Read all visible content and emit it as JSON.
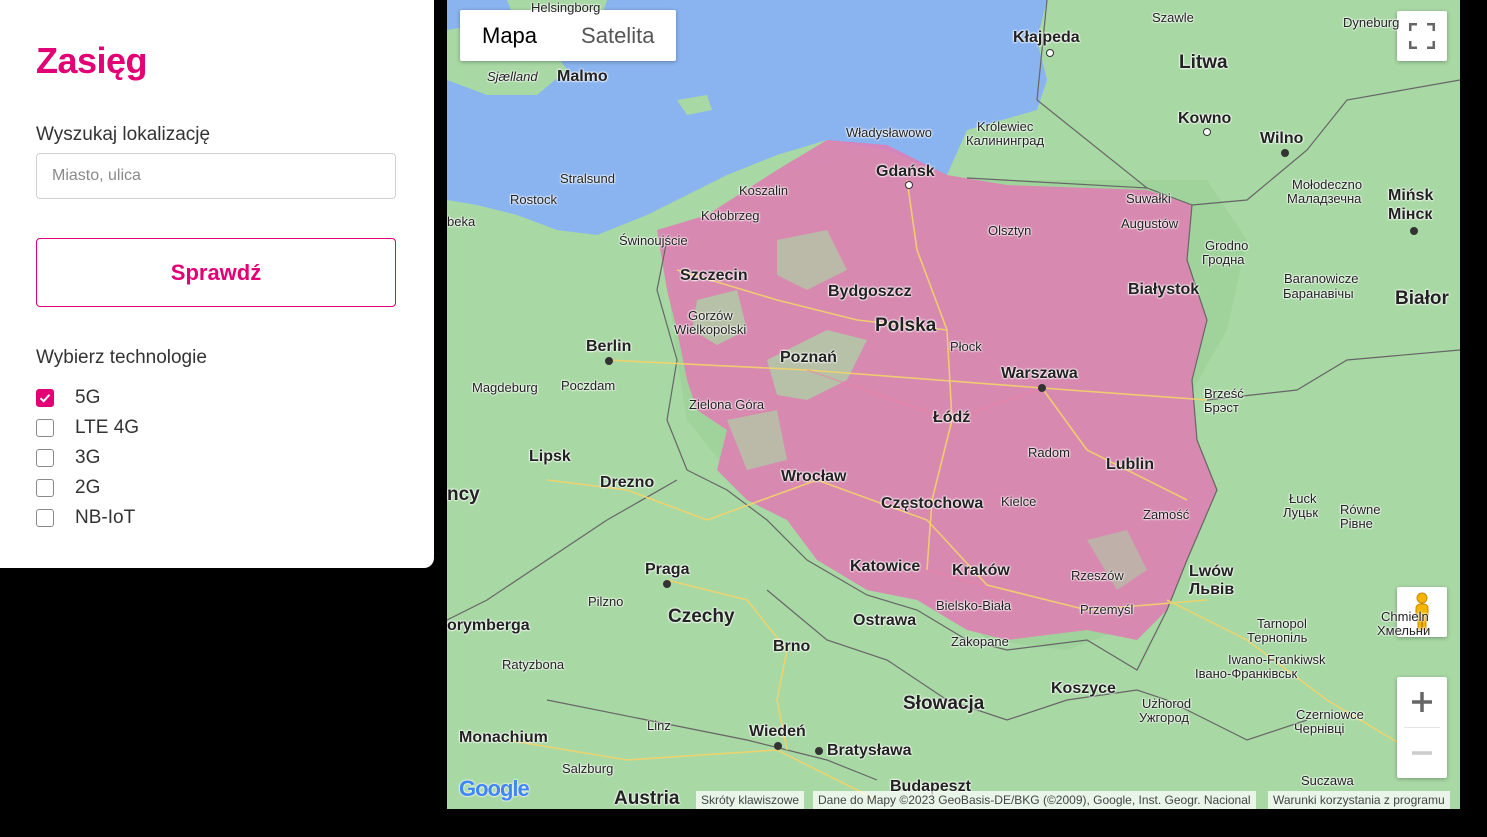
{
  "panel": {
    "title": "Zasięg",
    "search_label": "Wyszukaj lokalizację",
    "search_placeholder": "Miasto, ulica",
    "search_value": "",
    "check_button": "Sprawdź",
    "tech_label": "Wybierz technologie",
    "technologies": [
      {
        "label": "5G",
        "checked": true
      },
      {
        "label": "LTE 4G",
        "checked": false
      },
      {
        "label": "3G",
        "checked": false
      },
      {
        "label": "2G",
        "checked": false
      },
      {
        "label": "NB-IoT",
        "checked": false
      }
    ]
  },
  "map": {
    "map_type_map": "Mapa",
    "map_type_satellite": "Satelita",
    "labels": {
      "helsingborg": "Helsingborg",
      "szawle": "Szawle",
      "dyneburg": "Dyneburg",
      "klajpeda": "Kłajpeda",
      "sjaelland": "Sjælland",
      "malmo": "Malmo",
      "litwa": "Litwa",
      "kowno": "Kowno",
      "wilno": "Wilno",
      "wladyslawowo": "Władysławowo",
      "krolewiec": "Królewiec",
      "kaliningrad": "Калининград",
      "gdansk": "Gdańsk",
      "stralsund": "Stralsund",
      "koszalin": "Koszalin",
      "rostock": "Rostock",
      "kolobrzeg": "Kołobrzeg",
      "lubeka": "beka",
      "swinoujscie": "Świnoujście",
      "olsztyn": "Olsztyn",
      "suwalki": "Suwałki",
      "augustow": "Augustów",
      "molodeczno": "Mołodeczno",
      "molodeczno_cyr": "Маладзечна",
      "minsk": "Mińsk",
      "minsk_cyr": "Мінск",
      "grodno": "Grodno",
      "grodno_cyr": "Гродна",
      "szczecin": "Szczecin",
      "bydgoszcz": "Bydgoszcz",
      "bialystok": "Białystok",
      "baranowicze": "Baranowicze",
      "baranowicze_cyr": "Баранавічы",
      "bialorus": "Białor",
      "gorzow": "Gorzów",
      "wielkopolski": "Wielkopolski",
      "polska": "Polska",
      "plock": "Płock",
      "berlin": "Berlin",
      "poznan": "Poznań",
      "warszawa": "Warszawa",
      "magdeburg": "Magdeburg",
      "poczdam": "Poczdam",
      "brzesc": "Brześć",
      "brzesc_cyr": "Брэст",
      "zielona_gora": "Zielona Góra",
      "lodz": "Łódź",
      "radom": "Radom",
      "lipsk": "Lipsk",
      "lublin": "Lublin",
      "wroclaw": "Wrocław",
      "drezno": "Drezno",
      "niemcy": "ncy",
      "czestochowa": "Częstochowa",
      "kielce": "Kielce",
      "luck": "Łuck",
      "luck_cyr": "Луцьк",
      "rowne": "Równe",
      "rowne_cyr": "Рівне",
      "zamosc": "Zamość",
      "praga": "Praga",
      "katowice": "Katowice",
      "krakow": "Kraków",
      "rzeszow": "Rzeszów",
      "lwow": "Lwów",
      "lwow_cyr": "Львів",
      "pilzno": "Pilzno",
      "bielsko": "Bielsko-Biała",
      "przemysl": "Przemyśl",
      "czechy": "Czechy",
      "ostrawa": "Ostrawa",
      "tarnopol": "Tarnopol",
      "tarnopol_cyr": "Тернопіль",
      "chmielnicki": "Chmieln",
      "chmielnicki_cyr": "Хмельни",
      "norymberga": "orymberga",
      "zakopane": "Zakopane",
      "brno": "Brno",
      "ratyzbona": "Ratyzbona",
      "iwano": "Iwano-Frankiwsk",
      "iwano_cyr": "Івано-Франківськ",
      "slowacja": "Słowacja",
      "koszyce": "Koszyce",
      "linz": "Linz",
      "uzhorod": "Użhorod",
      "uzhorod_cyr": "Ужгород",
      "wieden": "Wiedeń",
      "monachium": "Monachium",
      "bratyslawa": "Bratysława",
      "czerniowce": "Czerniowce",
      "czerniowce_cyr": "Чернівці",
      "salzburg": "Salzburg",
      "budapeszt": "Budapeszt",
      "suczawa": "Suczawa",
      "austria": "Austria"
    },
    "google_logo": "Google",
    "attr_shortcuts": "Skróty klawiszowe",
    "attr_data": "Dane do Mapy ©2023 GeoBasis-DE/BKG (©2009), Google, Inst. Geogr. Nacional",
    "attr_terms": "Warunki korzystania z programu"
  },
  "colors": {
    "brand": "#e20074",
    "coverage": "#e07bb4",
    "sea": "#8ab4f0",
    "land": "#a8d8a4"
  }
}
